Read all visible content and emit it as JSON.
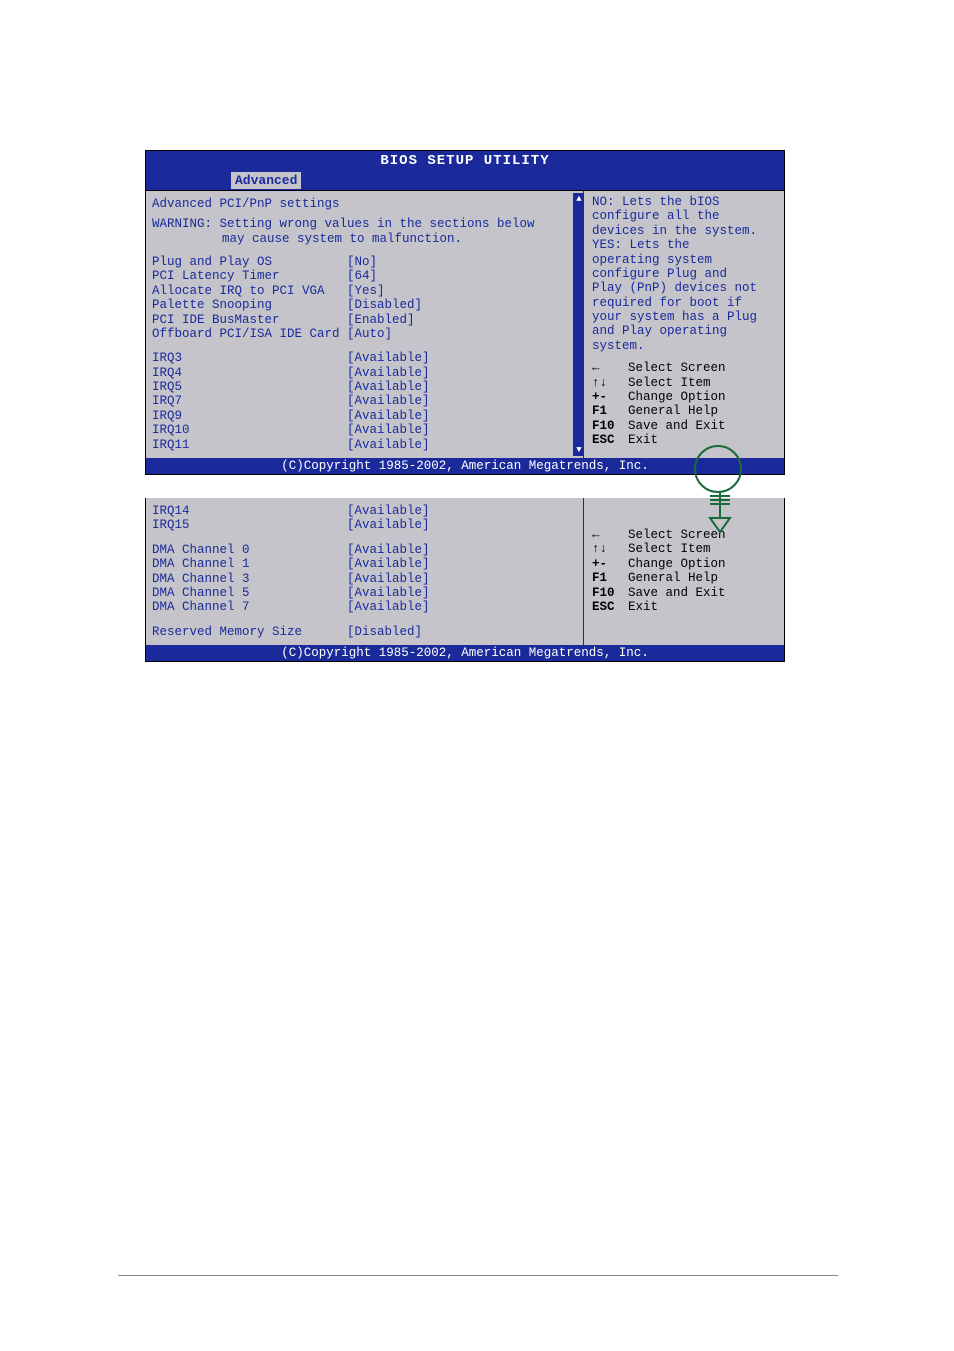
{
  "title": "BIOS SETUP UTILITY",
  "menu": {
    "active": "Advanced"
  },
  "panel1": {
    "heading": "Advanced PCI/PnP settings",
    "warning_line1": "WARNING: Setting wrong values in the sections below",
    "warning_line2": "may cause system to malfunction.",
    "options": [
      {
        "label": "Plug and Play OS",
        "value": "[No]"
      },
      {
        "label": "PCI Latency Timer",
        "value": "[64]"
      },
      {
        "label": "Allocate IRQ to PCI VGA",
        "value": "[Yes]"
      },
      {
        "label": "Palette Snooping",
        "value": "[Disabled]"
      },
      {
        "label": "PCI IDE BusMaster",
        "value": "[Enabled]"
      },
      {
        "label": "Offboard PCI/ISA IDE Card",
        "value": "[Auto]"
      }
    ],
    "irqs": [
      {
        "label": "IRQ3",
        "value": "[Available]"
      },
      {
        "label": "IRQ4",
        "value": "[Available]"
      },
      {
        "label": "IRQ5",
        "value": "[Available]"
      },
      {
        "label": "IRQ7",
        "value": "[Available]"
      },
      {
        "label": "IRQ9",
        "value": "[Available]"
      },
      {
        "label": "IRQ10",
        "value": "[Available]"
      },
      {
        "label": "IRQ11",
        "value": "[Available]"
      }
    ],
    "help": {
      "l1": "NO: Lets the bIOS",
      "l2": "configure all the",
      "l3": "devices in the system.",
      "l4": "YES: Lets the",
      "l5": "operating system",
      "l6": "configure Plug and",
      "l7": "Play (PnP) devices not",
      "l8": "required for boot if",
      "l9": "your system has a Plug",
      "l10": "and Play operating",
      "l11": "system."
    }
  },
  "panel2": {
    "irqs": [
      {
        "label": "IRQ14",
        "value": "[Available]"
      },
      {
        "label": "IRQ15",
        "value": "[Available]"
      }
    ],
    "dma": [
      {
        "label": "DMA Channel 0",
        "value": "[Available]"
      },
      {
        "label": "DMA Channel 1",
        "value": "[Available]"
      },
      {
        "label": "DMA Channel 3",
        "value": "[Available]"
      },
      {
        "label": "DMA Channel 5",
        "value": "[Available]"
      },
      {
        "label": "DMA Channel 7",
        "value": "[Available]"
      }
    ],
    "reserved": {
      "label": "Reserved Memory Size",
      "value": "[Disabled]"
    }
  },
  "keys": {
    "arrow_lr": "←",
    "arrow_ud": "↑↓",
    "plusminus": "+-",
    "f1": "F1",
    "f10": "F10",
    "esc": "ESC",
    "select_screen": "Select Screen",
    "select_item": "Select Item",
    "change_option": "Change Option",
    "general_help": "General Help",
    "save_exit": "Save and Exit",
    "exit": "Exit"
  },
  "copyright": "(C)Copyright 1985-2002, American Megatrends, Inc."
}
